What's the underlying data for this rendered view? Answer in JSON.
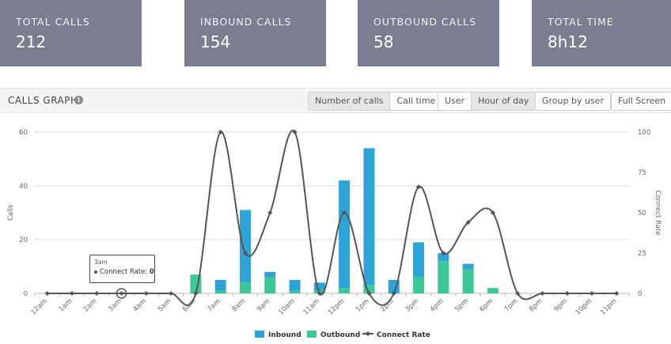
{
  "stats": [
    {
      "label": "TOTAL CALLS",
      "value": "212"
    },
    {
      "label": "INBOUND CALLS",
      "value": "154"
    },
    {
      "label": "OUTBOUND CALLS",
      "value": "58"
    },
    {
      "label": "TOTAL TIME",
      "value": "8h12"
    }
  ],
  "panel": {
    "title": "CALLS GRAPH",
    "info_icon": "i",
    "buttons": {
      "number_of_calls": "Number of calls",
      "call_time": "Call time",
      "user": "User",
      "hour_of_day": "Hour of day",
      "group_by_user": "Group by user",
      "full_screen": "Full Screen"
    }
  },
  "tooltip": {
    "time": "3am",
    "series": "Connect Rate:",
    "value": "0"
  },
  "colors": {
    "inbound": "#2ea3d6",
    "outbound": "#3dc797",
    "connect_rate": "#555555",
    "card": "#7b7e8e"
  },
  "chart_data": {
    "type": "bar",
    "stacked": true,
    "categories": [
      "12am",
      "1am",
      "2am",
      "3am",
      "4am",
      "5am",
      "6am",
      "7am",
      "8am",
      "9am",
      "10am",
      "11am",
      "12pm",
      "1pm",
      "2pm",
      "3pm",
      "4pm",
      "5pm",
      "6pm",
      "7pm",
      "8pm",
      "9pm",
      "10pm",
      "11pm"
    ],
    "series": [
      {
        "name": "Inbound",
        "axis": "left",
        "values": [
          0,
          0,
          0,
          0,
          0,
          0,
          0,
          4,
          27,
          2,
          4,
          3,
          40,
          51,
          5,
          13,
          3,
          2,
          0,
          0,
          0,
          0,
          0,
          0
        ]
      },
      {
        "name": "Outbound",
        "axis": "left",
        "values": [
          0,
          0,
          0,
          0,
          0,
          0,
          7,
          1,
          4,
          6,
          1,
          1,
          2,
          3,
          0,
          6,
          12,
          9,
          2,
          0,
          0,
          0,
          0,
          0
        ]
      },
      {
        "name": "Connect Rate",
        "type": "line",
        "axis": "right",
        "values": [
          0,
          0,
          0,
          0,
          0,
          0,
          0,
          100,
          25,
          50,
          100,
          0,
          50,
          0,
          0,
          66,
          25,
          44,
          50,
          0,
          0,
          0,
          0,
          0
        ]
      }
    ],
    "ylabel": "Calls",
    "y2label": "Connect Rate",
    "ylim": [
      0,
      60
    ],
    "y2lim": [
      0,
      100
    ],
    "yticks": [
      "0",
      "20",
      "40",
      "60"
    ],
    "y2ticks": [
      "0",
      "25",
      "50",
      "75",
      "100"
    ],
    "legend": "bottom-center",
    "grid": true
  }
}
